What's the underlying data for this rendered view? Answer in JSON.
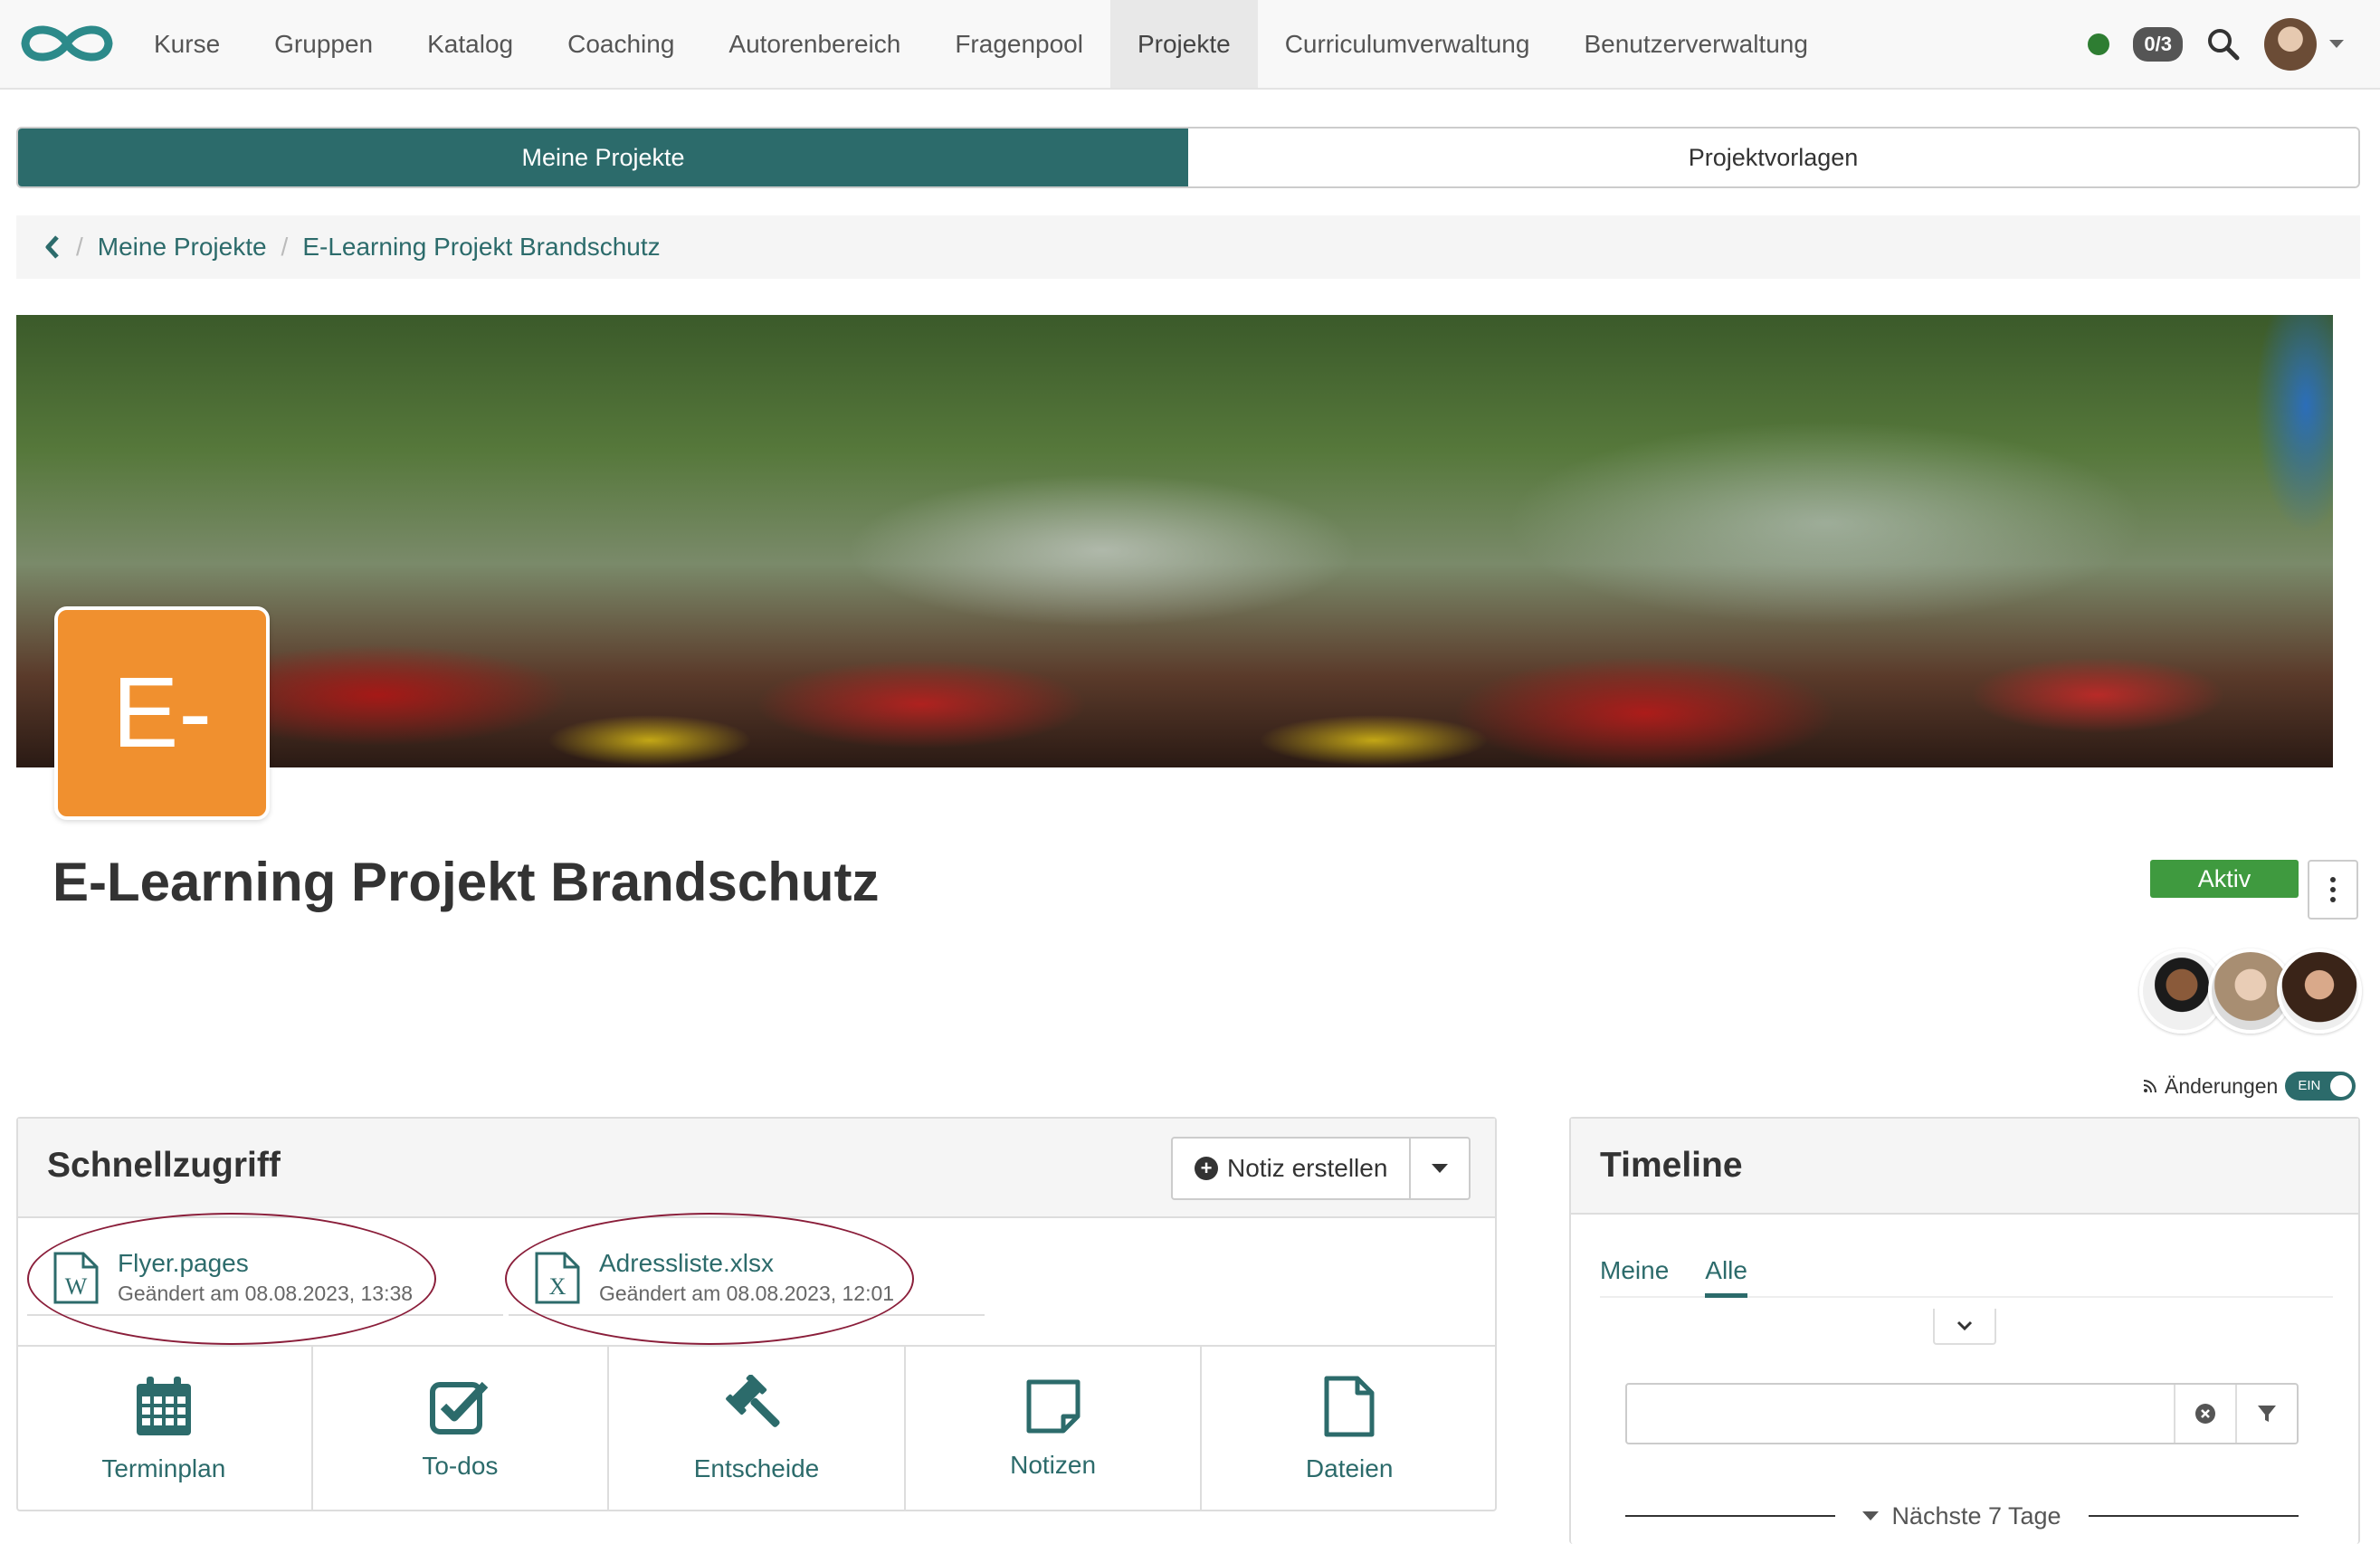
{
  "nav": {
    "items": [
      "Kurse",
      "Gruppen",
      "Katalog",
      "Coaching",
      "Autorenbereich",
      "Fragenpool",
      "Projekte",
      "Curriculumverwaltung",
      "Benutzerverwaltung"
    ],
    "active_index": 6,
    "online_count": "0/3"
  },
  "tabs": {
    "mine": "Meine Projekte",
    "templates": "Projektvorlagen"
  },
  "breadcrumb": {
    "parent": "Meine Projekte",
    "current": "E-Learning Projekt Brandschutz"
  },
  "project": {
    "tile_text": "E-",
    "title": "E-Learning Projekt Brandschutz",
    "status": "Aktiv",
    "changes_label": "Änderungen",
    "changes_toggle": "EIN",
    "tile_color": "#f0902f"
  },
  "quick": {
    "title": "Schnellzugriff",
    "note_button": "Notiz erstellen",
    "files": [
      {
        "name": "Flyer.pages",
        "date": "Geändert am 08.08.2023, 13:38",
        "icon": "word-document-icon",
        "letter": "W"
      },
      {
        "name": "Adressliste.xlsx",
        "date": "Geändert am 08.08.2023, 12:01",
        "icon": "excel-document-icon",
        "letter": "X"
      }
    ],
    "tiles": [
      {
        "label": "Terminplan",
        "icon": "calendar-icon"
      },
      {
        "label": "To-dos",
        "icon": "checkbox-icon"
      },
      {
        "label": "Entscheide",
        "icon": "gavel-icon"
      },
      {
        "label": "Notizen",
        "icon": "note-icon"
      },
      {
        "label": "Dateien",
        "icon": "file-icon"
      }
    ]
  },
  "timeline": {
    "title": "Timeline",
    "tabs": [
      "Meine",
      "Alle"
    ],
    "active_tab": 1,
    "search_value": "",
    "group_label": "Nächste 7 Tage"
  },
  "colors": {
    "accent": "#2c6b6b",
    "active_status": "#3f9a3f",
    "annotation": "#8a1e3a"
  }
}
